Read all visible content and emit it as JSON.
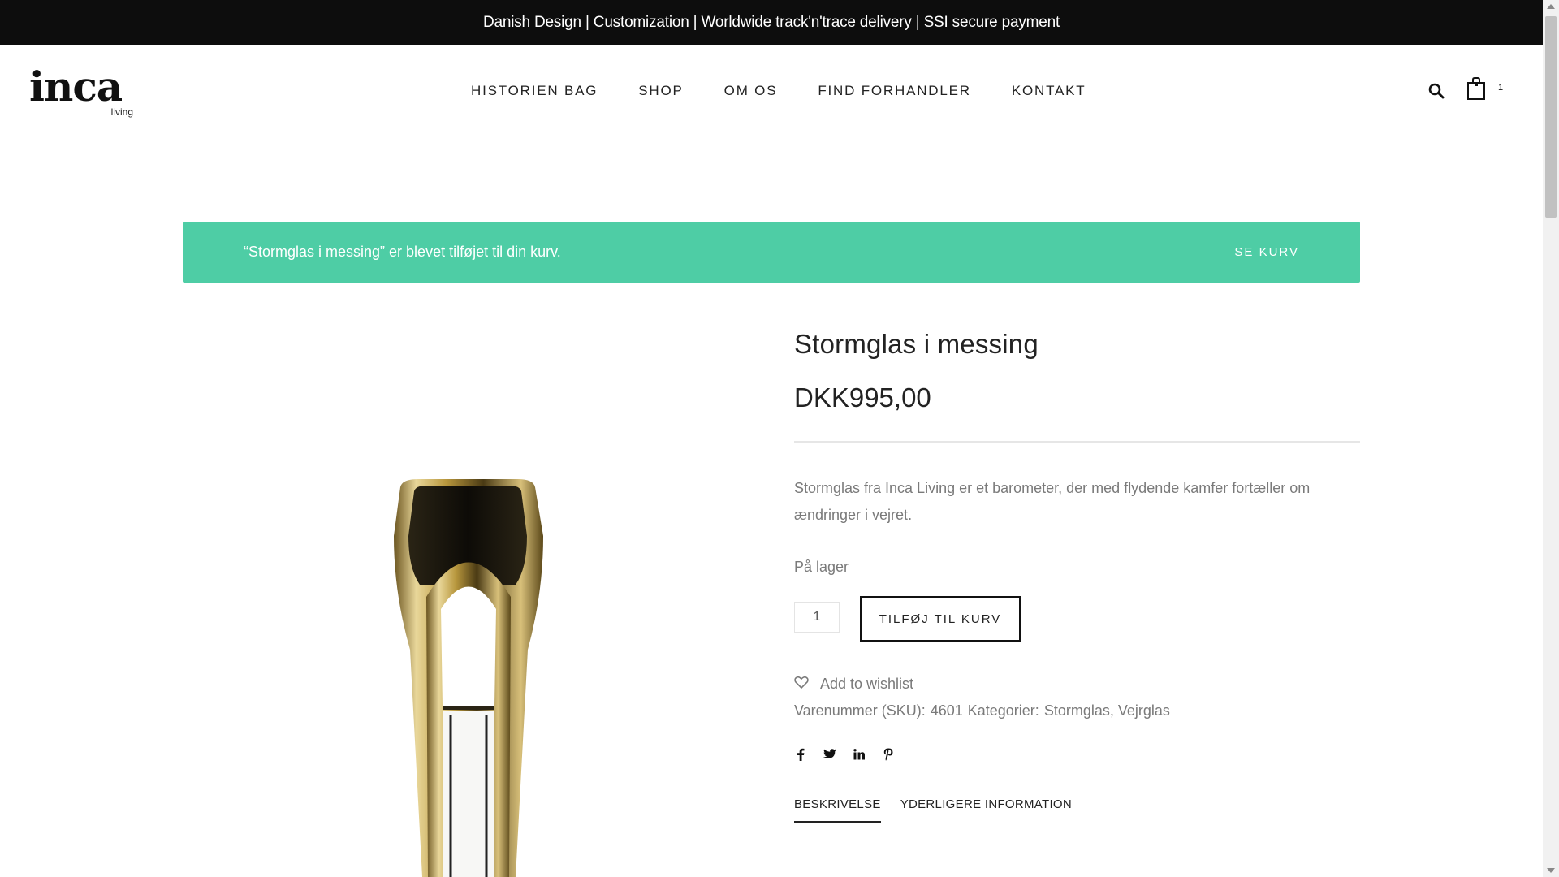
{
  "topbar": {
    "text": "Danish Design | Customization | Worldwide track'n'trace delivery | SSI secure payment"
  },
  "logo": {
    "word": "inca",
    "sub": "living"
  },
  "nav": [
    "HISTORIEN BAG",
    "SHOP",
    "OM OS",
    "FIND FORHANDLER",
    "KONTAKT"
  ],
  "header": {
    "cart_count": "1",
    "search_icon": "search-icon",
    "cart_icon": "shopping-bag-icon"
  },
  "notice": {
    "message": "“Stormglas i messing” er blevet tilføjet til din kurv.",
    "view_cart": "SE KURV",
    "color": "#4ecda5"
  },
  "product": {
    "title": "Stormglas i messing",
    "price": "DKK995,00",
    "description": "Stormglas fra Inca Living er et barometer, der med flydende kamfer fortæller om ændringer i vejret.",
    "stock": "På lager",
    "quantity": "1",
    "add_to_cart": "TILFØJ TIL KURV",
    "wishlist": "Add to wishlist",
    "sku_label": "Varenummer (SKU):",
    "sku": "4601",
    "categories_label": "Kategorier:",
    "categories": "Stormglas, Vejrglas"
  },
  "social": [
    "facebook-icon",
    "twitter-icon",
    "linkedin-icon",
    "pinterest-icon"
  ],
  "tabs": [
    "BESKRIVELSE",
    "YDERLIGERE INFORMATION"
  ]
}
